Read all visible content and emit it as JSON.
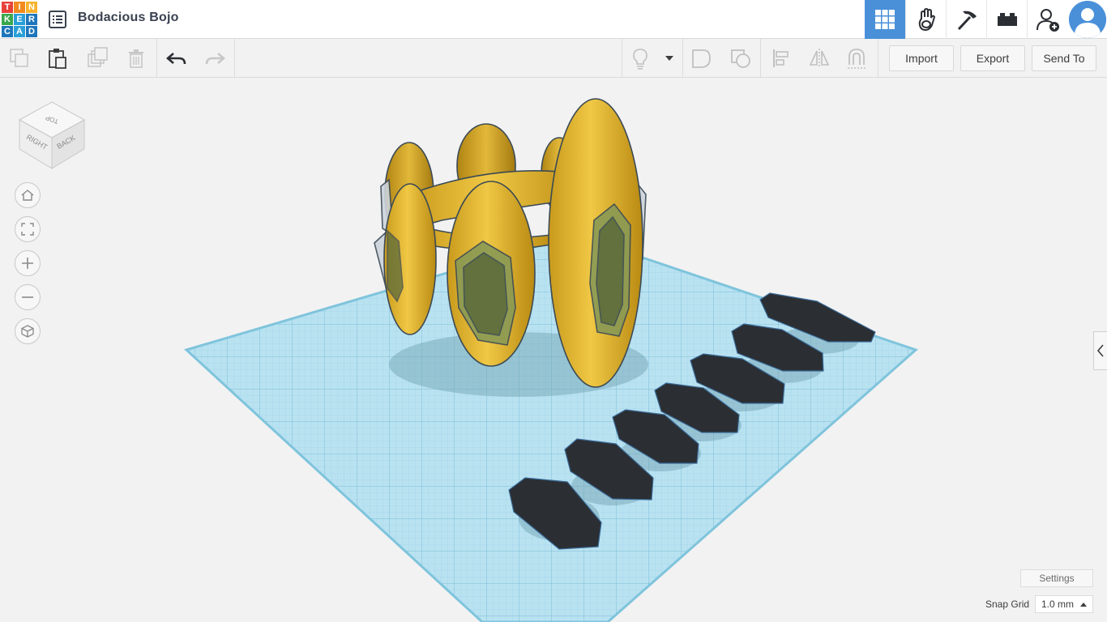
{
  "app": {
    "logo_letters": [
      "T",
      "I",
      "N",
      "K",
      "E",
      "R",
      "C",
      "A",
      "D"
    ]
  },
  "header": {
    "design_title": "Bodacious Bojo",
    "buttons": [
      {
        "name": "3d-design-view",
        "icon": "grid-icon",
        "active": true
      },
      {
        "name": "blocks-view",
        "icon": "glove-hand-icon",
        "active": false
      },
      {
        "name": "bricks-view",
        "icon": "pickaxe-icon",
        "active": false
      },
      {
        "name": "lego-view",
        "icon": "brick-icon",
        "active": false
      },
      {
        "name": "invite-user",
        "icon": "add-user-icon",
        "active": false
      }
    ]
  },
  "toolbar": {
    "import_label": "Import",
    "export_label": "Export",
    "send_to_label": "Send To"
  },
  "viewcube": {
    "top_label": "TOP",
    "right_label": "RIGHT",
    "back_label": "BACK"
  },
  "workplane": {
    "settings_label": "Settings",
    "snap_grid_label": "Snap Grid",
    "snap_grid_value": "1.0 mm"
  },
  "colors": {
    "accent": "#4a90d9",
    "workplane": "#a9dbee",
    "gold_shape": "#e8bb3a",
    "dark_shape": "#2b2e33"
  }
}
